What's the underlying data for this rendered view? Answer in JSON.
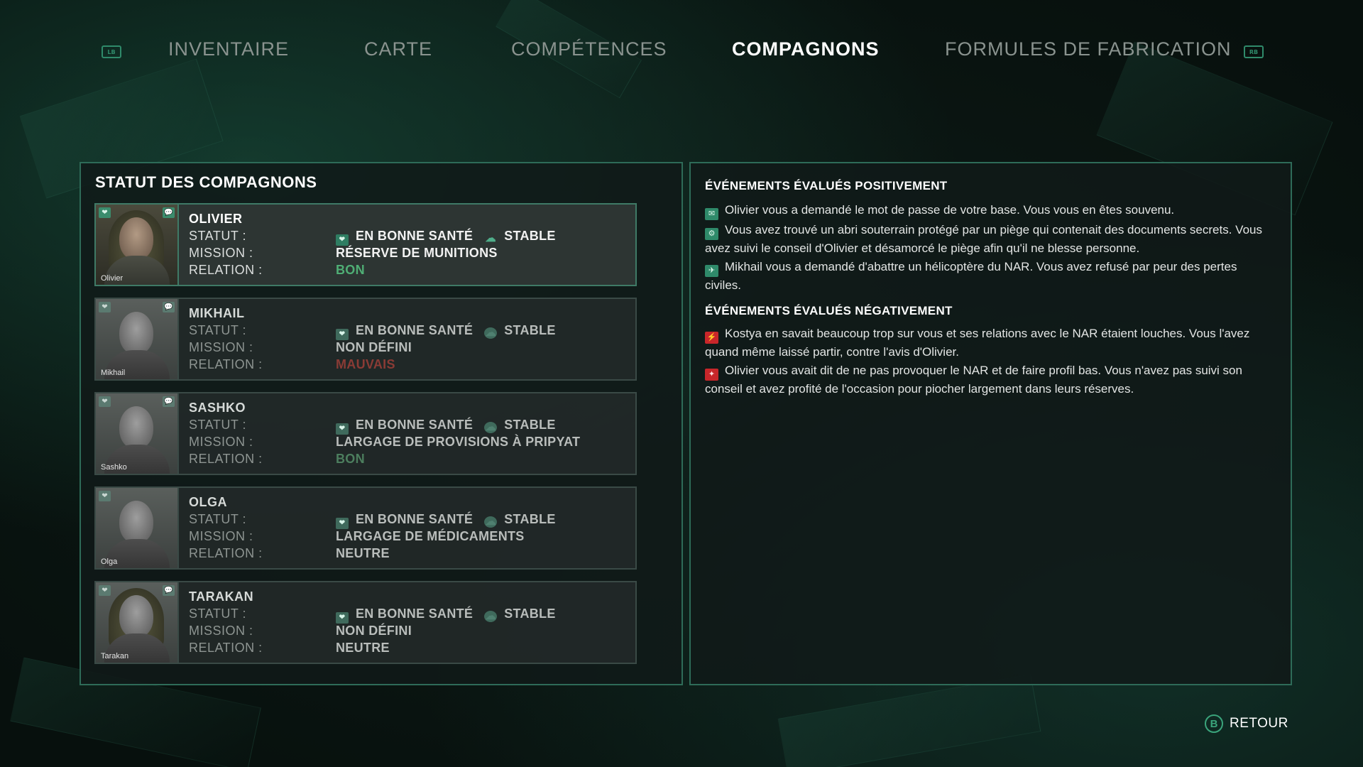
{
  "nav": {
    "left_bumper_icon": "lb-bumper-icon",
    "right_bumper_icon": "rb-bumper-icon",
    "tabs": [
      {
        "label": "INVENTAIRE",
        "active": false
      },
      {
        "label": "CARTE",
        "active": false
      },
      {
        "label": "COMPÉTENCES",
        "active": false
      },
      {
        "label": "COMPAGNONS",
        "active": true
      },
      {
        "label": "FORMULES DE FABRICATION",
        "active": false
      }
    ]
  },
  "status_panel": {
    "title": "STATUT DES COMPAGNONS",
    "labels": {
      "status": "STATUT :",
      "mission": "MISSION :",
      "relation": "RELATION :"
    },
    "companions": [
      {
        "name": "OLIVIER",
        "portrait_name": "Olivier",
        "health": "EN BONNE SANTÉ",
        "mood": "STABLE",
        "mission": "RÉSERVE DE MUNITIONS",
        "relation": "BON",
        "relation_color": "#4fae75",
        "selected": true
      },
      {
        "name": "MIKHAIL",
        "portrait_name": "Mikhail",
        "health": "EN BONNE SANTÉ",
        "mood": "STABLE",
        "mission": "NON DÉFINI",
        "relation": "MAUVAIS",
        "relation_color": "#8a3b35",
        "selected": false
      },
      {
        "name": "SASHKO",
        "portrait_name": "Sashko",
        "health": "EN BONNE SANTÉ",
        "mood": "STABLE",
        "mission": "LARGAGE DE PROVISIONS À PRIPYAT",
        "relation": "BON",
        "relation_color": "#4c7e5e",
        "selected": false
      },
      {
        "name": "OLGA",
        "portrait_name": "Olga",
        "health": "EN BONNE SANTÉ",
        "mood": "STABLE",
        "mission": "LARGAGE DE MÉDICAMENTS",
        "relation": "NEUTRE",
        "relation_color": "#b9bdbb",
        "selected": false
      },
      {
        "name": "TARAKAN",
        "portrait_name": "Tarakan",
        "health": "EN BONNE SANTÉ",
        "mood": "STABLE",
        "mission": "NON DÉFINI",
        "relation": "NEUTRE",
        "relation_color": "#b9bdbb",
        "selected": false
      }
    ]
  },
  "events_panel": {
    "positive_title": "ÉVÉNEMENTS ÉVALUÉS POSITIVEMENT",
    "positive": [
      {
        "icon": "speech-bubble-icon",
        "text": "Olivier vous a demandé le mot de passe de votre base. Vous vous en êtes souvenu."
      },
      {
        "icon": "trap-icon",
        "text": "Vous avez trouvé un abri souterrain protégé par un piège qui contenait des documents secrets. Vous avez suivi le conseil d'Olivier et désamorcé le piège afin qu'il ne blesse personne."
      },
      {
        "icon": "helicopter-icon",
        "text": "Mikhail vous a demandé d'abattre un hélicoptère du NAR. Vous avez refusé par peur des pertes civiles."
      }
    ],
    "negative_title": "ÉVÉNEMENTS ÉVALUÉS NÉGATIVEMENT",
    "negative": [
      {
        "icon": "running-man-icon",
        "text": "Kostya en savait beaucoup trop sur vous et ses relations avec le NAR étaient louches. Vous l'avez quand même laissé partir, contre l'avis d'Olivier."
      },
      {
        "icon": "loot-icon",
        "text": "Olivier vous avait dit de ne pas provoquer le NAR et de faire profil bas. Vous n'avez pas suivi son conseil et avez profité de l'occasion pour piocher largement dans leurs réserves."
      }
    ]
  },
  "footer": {
    "back_button_glyph": "B",
    "back_label": "RETOUR"
  }
}
